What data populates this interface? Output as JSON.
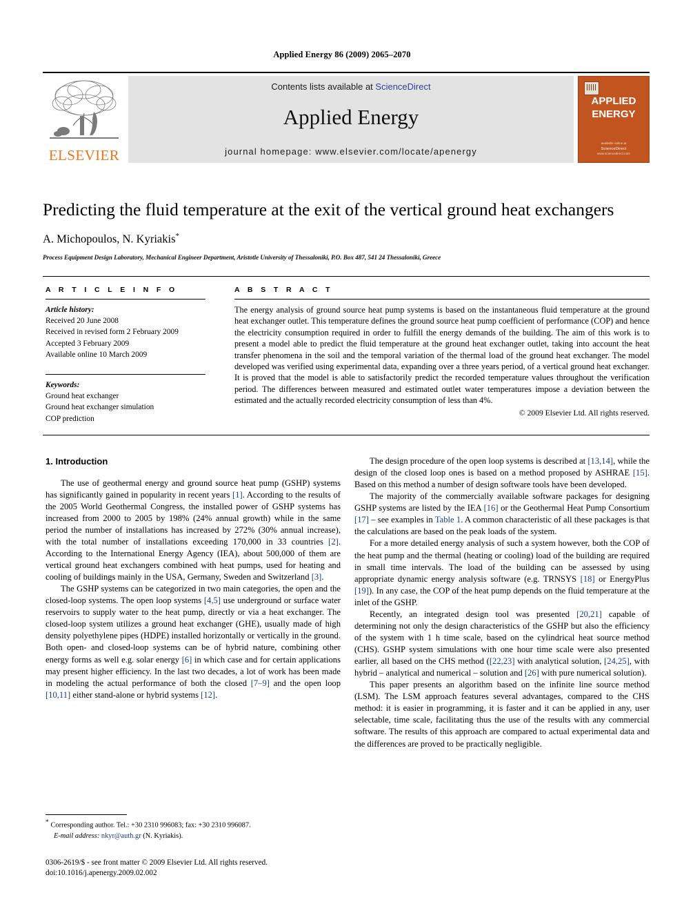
{
  "running_head": "Applied Energy 86 (2009) 2065–2070",
  "masthead": {
    "publisher_name": "ELSEVIER",
    "contents_line_prefix": "Contents lists available at ",
    "sciencedirect": "ScienceDirect",
    "journal_title": "Applied Energy",
    "homepage_line": "journal homepage: www.elsevier.com/locate/apenergy",
    "cover": {
      "line1": "APPLIED",
      "line2": "ENERGY",
      "footer_small": "available online at",
      "footer_brand": "ScienceDirect",
      "footer_url": "www.sciencedirect.com"
    }
  },
  "article": {
    "title": "Predicting the fluid temperature at the exit of the vertical ground heat exchangers",
    "authors": "A. Michopoulos, N. Kyriakis",
    "corresponding_marker": "*",
    "affiliation": "Process Equipment Design Laboratory, Mechanical Engineer Department, Aristotle University of Thessaloniki, P.O. Box 487, 541 24 Thessaloniki, Greece"
  },
  "info": {
    "heading": "A R T I C L E   I N F O",
    "history_label": "Article history:",
    "history": [
      "Received 20 June 2008",
      "Received in revised form 2 February 2009",
      "Accepted 3 February 2009",
      "Available online 10 March 2009"
    ],
    "keywords_label": "Keywords:",
    "keywords": [
      "Ground heat exchanger",
      "Ground heat exchanger simulation",
      "COP prediction"
    ]
  },
  "abstract": {
    "heading": "A B S T R A C T",
    "text": "The energy analysis of ground source heat pump systems is based on the instantaneous fluid temperature at the ground heat exchanger outlet. This temperature defines the ground source heat pump coefficient of performance (COP) and hence the electricity consumption required in order to fulfill the energy demands of the building. The aim of this work is to present a model able to predict the fluid temperature at the ground heat exchanger outlet, taking into account the heat transfer phenomena in the soil and the temporal variation of the thermal load of the ground heat exchanger. The model developed was verified using experimental data, expanding over a three years period, of a vertical ground heat exchanger. It is proved that the model is able to satisfactorily predict the recorded temperature values throughout the verification period. The differences between measured and estimated outlet water temperatures impose a deviation between the estimated and the actually recorded electricity consumption of less than 4%.",
    "copyright": "© 2009 Elsevier Ltd. All rights reserved."
  },
  "body": {
    "section_heading": "1. Introduction",
    "left": {
      "p1_a": "The use of geothermal energy and ground source heat pump (GSHP) systems has significantly gained in popularity in recent years ",
      "p1_r1": "[1]",
      "p1_b": ". According to the results of the 2005 World Geothermal Congress, the installed power of GSHP systems has increased from 2000 to 2005 by 198% (24% annual growth) while in the same period the number of installations has increased by 272% (30% annual increase), with the total number of installations exceeding 170,000 in 33 countries ",
      "p1_r2": "[2]",
      "p1_c": ". According to the International Energy Agency (IEA), about 500,000 of them are vertical ground heat exchangers combined with heat pumps, used for heating and cooling of buildings mainly in the USA, Germany, Sweden and Switzerland ",
      "p1_r3": "[3]",
      "p1_d": ".",
      "p2_a": "The GSHP systems can be categorized in two main categories, the open and the closed-loop systems. The open loop systems ",
      "p2_r1": "[4,5]",
      "p2_b": " use underground or surface water reservoirs to supply water to the heat pump, directly or via a heat exchanger. The closed-loop system utilizes a ground heat exchanger (GHE), usually made of high density polyethylene pipes (HDPE) installed horizontally or vertically in the ground. Both open- and closed-loop systems can be of hybrid nature, combining other energy forms as well e.g. solar energy ",
      "p2_r2": "[6]",
      "p2_c": " in which case and for certain applications may present higher efficiency. In the last two decades, a lot of work has been made in modeling the actual performance of both the closed ",
      "p2_r3": "[7–9]",
      "p2_d": " and the open loop ",
      "p2_r4": "[10,11]",
      "p2_e": " either stand-alone or hybrid systems ",
      "p2_r5": "[12]",
      "p2_f": "."
    },
    "right": {
      "p3_a": "The design procedure of the open loop systems is described at ",
      "p3_r1": "[13,14]",
      "p3_b": ", while the design of the closed loop ones is based on a method proposed by ASHRAE ",
      "p3_r2": "[15]",
      "p3_c": ". Based on this method a number of design software tools have been developed.",
      "p4_a": "The majority of the commercially available software packages for designing GSHP systems are listed by the IEA ",
      "p4_r1": "[16]",
      "p4_b": " or the Geothermal Heat Pump Consortium ",
      "p4_r2": "[17]",
      "p4_c": " – see examples in ",
      "p4_r3": "Table 1",
      "p4_d": ". A common characteristic of all these packages is that the calculations are based on the peak loads of the system.",
      "p5_a": "For a more detailed energy analysis of such a system however, both the COP of the heat pump and the thermal (heating or cooling) load of the building are required in small time intervals. The load of the building can be assessed by using appropriate dynamic energy analysis software (e.g. TRNSYS ",
      "p5_r1": "[18]",
      "p5_b": " or EnergyPlus ",
      "p5_r2": "[19]",
      "p5_c": "). In any case, the COP of the heat pump depends on the fluid temperature at the inlet of the GSHP.",
      "p6_a": "Recently, an integrated design tool was presented ",
      "p6_r1": "[20,21]",
      "p6_b": " capable of determining not only the design characteristics of the GSHP but also the efficiency of the system with 1 h time scale, based on the cylindrical heat source method (CHS). GSHP system simulations with one hour time scale were also presented earlier, all based on the CHS method (",
      "p6_r2": "[22,23]",
      "p6_c": " with analytical solution, ",
      "p6_r3": "[24,25]",
      "p6_d": ", with hybrid – analytical and numerical – solution and ",
      "p6_r4": "[26]",
      "p6_e": " with pure numerical solution).",
      "p7": "This paper presents an algorithm based on the infinite line source method (LSM). The LSM approach features several advantages, compared to the CHS method: it is easier in programming, it is faster and it can be applied in any, user selectable, time scale, facilitating thus the use of the results with any commercial software. The results of this approach are compared to actual experimental data and the differences are proved to be practically negligible."
    }
  },
  "footnote": {
    "star": "*",
    "corresponding": "Corresponding author. Tel.: +30 2310 996083; fax: +30 2310 996087.",
    "email_label": "E-mail address:",
    "email": "nkyr@auth.gr",
    "email_suffix": "(N. Kyriakis)."
  },
  "imprint": {
    "line1": "0306-2619/$ - see front matter © 2009 Elsevier Ltd. All rights reserved.",
    "line2": "doi:10.1016/j.apenergy.2009.02.002"
  },
  "colors": {
    "elsevier_orange": "#E87722",
    "cover_orange": "#C2551F",
    "link_blue": "#1a3a8f",
    "sciencedirect_blue": "#2b3f9e",
    "banner_grey": "#e3e3e3"
  }
}
